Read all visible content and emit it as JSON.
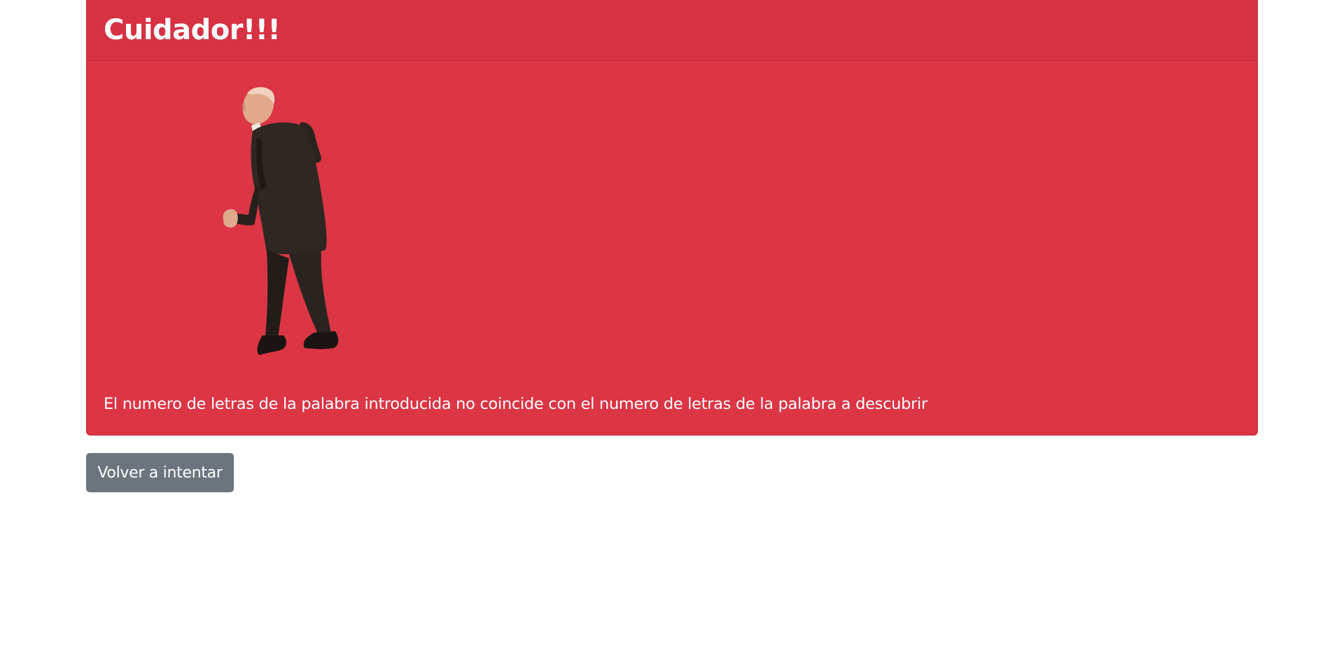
{
  "alert": {
    "title": "Cuidador!!!",
    "message": "El numero de letras de la palabra introducida no coincide con el numero de letras de la palabra a descubrir",
    "image": {
      "icon": "walking-man-figure"
    },
    "colors": {
      "background": "#dc3545",
      "header": "#d63244",
      "text": "#ffffff"
    }
  },
  "actions": {
    "retry_label": "Volver a intentar",
    "retry_color": "#6c757d"
  }
}
